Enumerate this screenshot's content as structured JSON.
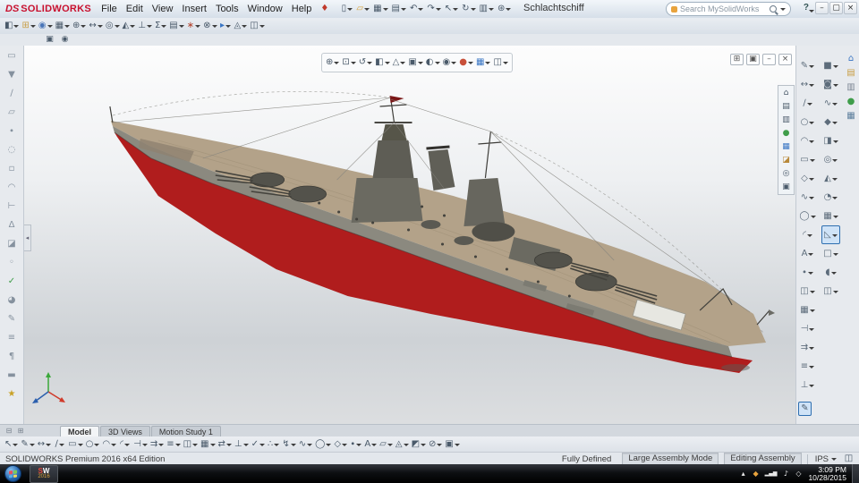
{
  "titlebar": {
    "brand_prefix": "DS",
    "brand": "SOLIDWORKS",
    "menus": [
      "File",
      "Edit",
      "View",
      "Insert",
      "Tools",
      "Window",
      "Help"
    ],
    "pin": [
      "pin-icon"
    ],
    "quick_icons": [
      "new-document-icon",
      "open-icon",
      "save-icon",
      "print-icon",
      "undo-icon",
      "redo-icon",
      "select-icon",
      "rebuild-icon",
      "file-properties-icon",
      "options-icon"
    ],
    "document_title": "Schlachtschiff",
    "search_placeholder": "Search MySolidWorks",
    "help_label": "?",
    "window_icons": [
      "minimize-icon",
      "maximize-icon",
      "close-icon"
    ]
  },
  "toolbar2": {
    "icons": [
      "edit-component-icon",
      "insert-components-icon",
      "mate-icon",
      "linear-component-pattern-icon",
      "smart-fasteners-icon",
      "move-component-icon",
      "show-hidden-components-icon",
      "assembly-features-icon",
      "reference-geometry-icon",
      "equations-icon",
      "bill-of-materials-icon",
      "exploded-view-icon",
      "interference-detection-icon",
      "new-motion-study-icon",
      "instant3d-icon",
      "large-assembly-mode-icon"
    ]
  },
  "toolbar3": {
    "icons": [
      "screenshot-icon",
      "record-video-icon"
    ]
  },
  "left_toolbar": {
    "icons": [
      "open-document-icon",
      "select-filter-icon",
      "filter-edges-icon",
      "filter-faces-icon",
      "filter-vertices-icon",
      "magnified-selection-icon",
      "box-selection-icon",
      "lasso-selection-icon",
      "measure-icon",
      "mass-properties-icon",
      "section-properties-icon",
      "sensor-icon",
      "check-icon",
      "appearance-editor-icon",
      "sketch-entities-icon",
      "notes-area-icon",
      "comment-icon",
      "design-binder-icon",
      "favorites-icon"
    ]
  },
  "heads_up": {
    "icons": [
      "zoom-to-fit-icon",
      "zoom-to-area-icon",
      "previous-view-icon",
      "section-view-icon",
      "dynamic-annotation-icon",
      "view-orientation-icon",
      "display-style-icon",
      "hide-show-items-icon",
      "edit-appearance-icon",
      "apply-scene-icon",
      "view-settings-icon"
    ]
  },
  "doc_controls": {
    "icons": [
      "tile-windows-icon",
      "restore-document-icon",
      "minimize-document-icon",
      "close-document-icon"
    ]
  },
  "right_palette": {
    "icons": [
      "home-icon",
      "page-icon",
      "folder-icon",
      "appearance-icon",
      "scene-icon",
      "decal-icon",
      "walkthrough-icon",
      "camera-icon"
    ]
  },
  "right_toolbar_primary": {
    "icons": [
      "sketch-icon",
      "smart-dimension-icon",
      "line-icon",
      "circle-icon",
      "arc-icon",
      "rectangle-icon",
      "polygon-icon",
      "spline-icon",
      "ellipse-icon",
      "sketch-fillet-icon",
      "sketch-text-icon",
      "point-icon",
      "mirror-entities-icon",
      "pattern-entities-icon",
      "trim-entities-icon",
      "convert-entities-icon",
      "offset-entities-icon",
      "display-relations-icon"
    ]
  },
  "right_toolbar_secondary": {
    "icons": [
      "extruded-boss-icon",
      "revolved-boss-icon",
      "swept-boss-icon",
      "lofted-boss-icon",
      "extruded-cut-icon",
      "hole-wizard-icon",
      "revolved-cut-icon",
      "fillet-icon",
      "linear-pattern-icon",
      {
        "name": "draft-icon",
        "pressed": true
      },
      "shell-icon",
      "wrap-icon",
      "mirror-icon"
    ]
  },
  "edit_sketch": {
    "icons": [
      {
        "name": "edit-sketch-icon",
        "pressed": true
      }
    ]
  },
  "task_pane": {
    "icons": [
      "solidworks-resources-icon",
      "design-library-icon",
      "file-explorer-icon",
      "appearances-scenes-icon",
      "custom-properties-icon"
    ]
  },
  "tabs": {
    "left_icons": [
      "split-horizontal-icon",
      "split-vertical-icon"
    ],
    "items": [
      {
        "label": "Model",
        "active": true
      },
      {
        "label": "3D Views",
        "active": false
      },
      {
        "label": "Motion Study 1",
        "active": false
      }
    ]
  },
  "sketchbar": {
    "icons": [
      "select-icon",
      "sketch-icon",
      "smart-dimension-icon",
      "line-icon",
      "corner-rectangle-icon",
      "circle-icon",
      "centerpoint-arc-icon",
      "sketch-fillet-icon",
      "trim-entities-icon",
      "convert-entities-icon",
      "offset-entities-icon",
      "mirror-entities-icon",
      "linear-sketch-pattern-icon",
      "move-entities-icon",
      "display-relations-icon",
      "repair-sketch-icon",
      "quick-snaps-icon",
      "rapid-sketch-icon",
      "spline-icon",
      "ellipse-icon",
      "polygon-icon",
      "point-icon",
      "sketch-text-icon",
      "plane-icon",
      "instant2d-icon",
      "shaded-contours-icon",
      "no-solve-icon",
      "sketch-picture-icon"
    ]
  },
  "statusbar": {
    "edition": "SOLIDWORKS Premium 2016 x64 Edition",
    "defined": "Fully Defined",
    "mode": "Large Assembly Mode",
    "editing": "Editing Assembly",
    "units": "IPS",
    "pane": [
      "status-pane-icon"
    ]
  },
  "taskbar": {
    "app_s": "S",
    "app_w": "W",
    "app_year": "2016",
    "tray_icons": [
      "show-hidden-icons-icon",
      "solidworks-rx-icon",
      "network-icon",
      "volume-icon",
      "action-center-icon"
    ],
    "time": "3:09 PM",
    "date": "10/28/2015"
  },
  "colors": {
    "brand_red": "#c8102e",
    "hull_red": "#b01d1d",
    "hull_red_dark": "#8e1616",
    "deck_tan": "#b3a289",
    "deck_tan_dark": "#9d8d74",
    "hull_gray": "#8b897f",
    "superstructure": "#6b6a61",
    "superstructure_dark": "#53524b",
    "tower_dark": "#5e5d55",
    "detail_dark": "#3a3935",
    "white_structure": "#e7e7e1",
    "flag_red": "#7a1616",
    "triad_x": "#d03a2a",
    "triad_y": "#3aa83a",
    "triad_z": "#2b5fae"
  },
  "icon_glyphs": {
    "pin-icon": "♦",
    "new-document-icon": "▯",
    "open-icon": "▱",
    "save-icon": "▦",
    "print-icon": "▤",
    "undo-icon": "↶",
    "redo-icon": "↷",
    "select-icon": "↖",
    "rebuild-icon": "↻",
    "file-properties-icon": "▥",
    "options-icon": "⊛",
    "minimize-icon": "–",
    "maximize-icon": "▢",
    "close-icon": "×",
    "edit-component-icon": "◧",
    "insert-components-icon": "⊞",
    "mate-icon": "◉",
    "linear-component-pattern-icon": "▦",
    "smart-fasteners-icon": "⊕",
    "move-component-icon": "↔",
    "show-hidden-components-icon": "◎",
    "assembly-features-icon": "◭",
    "reference-geometry-icon": "⊥",
    "equations-icon": "Σ",
    "bill-of-materials-icon": "▤",
    "exploded-view-icon": "∗",
    "interference-detection-icon": "⊗",
    "new-motion-study-icon": "▸",
    "instant3d-icon": "◬",
    "large-assembly-mode-icon": "◫",
    "screenshot-icon": "▣",
    "record-video-icon": "◉",
    "open-document-icon": "▭",
    "select-filter-icon": "▼",
    "filter-edges-icon": "∕",
    "filter-faces-icon": "▱",
    "filter-vertices-icon": "∙",
    "magnified-selection-icon": "◌",
    "box-selection-icon": "▫",
    "lasso-selection-icon": "◠",
    "measure-icon": "⊢",
    "mass-properties-icon": "Δ",
    "section-properties-icon": "◪",
    "sensor-icon": "◦",
    "check-icon": "✓",
    "appearance-editor-icon": "◕",
    "sketch-entities-icon": "✎",
    "notes-area-icon": "≡",
    "comment-icon": "¶",
    "design-binder-icon": "▬",
    "favorites-icon": "★",
    "zoom-to-fit-icon": "⊕",
    "zoom-to-area-icon": "⊡",
    "previous-view-icon": "↺",
    "section-view-icon": "◧",
    "dynamic-annotation-icon": "△",
    "view-orientation-icon": "▣",
    "display-style-icon": "◐",
    "hide-show-items-icon": "◉",
    "edit-appearance-icon": "●",
    "apply-scene-icon": "▦",
    "view-settings-icon": "◫",
    "tile-windows-icon": "⊞",
    "restore-document-icon": "▣",
    "minimize-document-icon": "–",
    "close-document-icon": "×",
    "home-icon": "⌂",
    "page-icon": "▤",
    "folder-icon": "▥",
    "appearance-icon": "●",
    "scene-icon": "▦",
    "decal-icon": "◪",
    "walkthrough-icon": "◎",
    "camera-icon": "▣",
    "sketch-icon": "✎",
    "smart-dimension-icon": "↔",
    "line-icon": "∕",
    "circle-icon": "○",
    "arc-icon": "◠",
    "rectangle-icon": "▭",
    "polygon-icon": "◇",
    "spline-icon": "∿",
    "ellipse-icon": "◯",
    "sketch-fillet-icon": "◜",
    "sketch-text-icon": "A",
    "point-icon": "∙",
    "mirror-entities-icon": "◫",
    "pattern-entities-icon": "▦",
    "trim-entities-icon": "⊣",
    "convert-entities-icon": "⇉",
    "offset-entities-icon": "≡",
    "display-relations-icon": "⊥",
    "extruded-boss-icon": "■",
    "revolved-boss-icon": "◙",
    "swept-boss-icon": "∿",
    "lofted-boss-icon": "◆",
    "extruded-cut-icon": "◨",
    "hole-wizard-icon": "◎",
    "revolved-cut-icon": "◭",
    "fillet-icon": "◔",
    "linear-pattern-icon": "▦",
    "draft-icon": "◺",
    "shell-icon": "□",
    "wrap-icon": "◖",
    "mirror-icon": "◫",
    "edit-sketch-icon": "✎",
    "solidworks-resources-icon": "⌂",
    "design-library-icon": "▤",
    "file-explorer-icon": "▥",
    "appearances-scenes-icon": "●",
    "custom-properties-icon": "▦",
    "split-horizontal-icon": "⊟",
    "split-vertical-icon": "⊞",
    "corner-rectangle-icon": "▭",
    "centerpoint-arc-icon": "◠",
    "linear-sketch-pattern-icon": "▦",
    "move-entities-icon": "⇄",
    "repair-sketch-icon": "✓",
    "quick-snaps-icon": "∴",
    "rapid-sketch-icon": "↯",
    "plane-icon": "▱",
    "instant2d-icon": "◬",
    "shaded-contours-icon": "◩",
    "no-solve-icon": "⊘",
    "sketch-picture-icon": "▣",
    "status-pane-icon": "◫",
    "show-hidden-icons-icon": "▴",
    "solidworks-rx-icon": "◆",
    "network-icon": "▂▄▆",
    "volume-icon": "♪",
    "action-center-icon": "◇"
  },
  "icon_colors": {
    "pin-icon": "#c0392b",
    "open-icon": "#d8a33a",
    "insert-components-icon": "#c9a04a",
    "mate-icon": "#4a76b8",
    "new-motion-study-icon": "#3a76c4",
    "exploded-view-icon": "#b4452f",
    "edit-appearance-icon": "#c8503a",
    "apply-scene-icon": "#3a76c4",
    "appearance-icon": "#3f9d4a",
    "scene-icon": "#3a76c4",
    "decal-icon": "#b8893a",
    "check-icon": "#3f9d4a",
    "favorites-icon": "#c9a227",
    "solidworks-resources-icon": "#3a76c4",
    "design-library-icon": "#c99f45",
    "file-explorer-icon": "#7d8794",
    "appearances-scenes-icon": "#3f9d4a",
    "custom-properties-icon": "#5d7f9d",
    "solidworks-rx-icon": "#e8a33d"
  }
}
